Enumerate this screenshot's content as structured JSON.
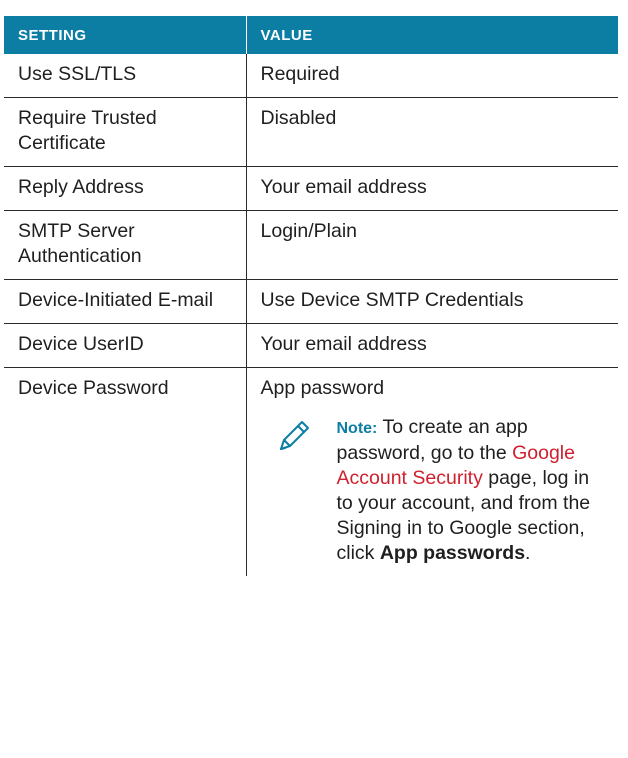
{
  "table": {
    "headers": [
      "SETTING",
      "VALUE"
    ],
    "rows": [
      {
        "setting": "Use SSL/TLS",
        "value": "Required"
      },
      {
        "setting": "Require Trusted Certificate",
        "value": "Disabled"
      },
      {
        "setting": "Reply Address",
        "value": "Your email address"
      },
      {
        "setting": "SMTP Server Authentication",
        "value": "Login/Plain"
      },
      {
        "setting": "Device-Initiated E-mail",
        "value": "Use Device SMTP Credentials"
      },
      {
        "setting": "Device UserID",
        "value": "Your email address"
      },
      {
        "setting": "Device Password",
        "value": "App password"
      }
    ]
  },
  "note": {
    "label": "Note:",
    "text_before_link": " To create an app password, go to the ",
    "link_text": "Google Account Security",
    "text_after_link": " page, log in to your account, and from the Signing in to Google section, click ",
    "bold_text": "App passwords",
    "text_end": "."
  },
  "colors": {
    "header_bg": "#0d7ea3",
    "link": "#d0202e",
    "border": "#2b2b2b"
  },
  "icons": {
    "note": "pencil-icon"
  }
}
